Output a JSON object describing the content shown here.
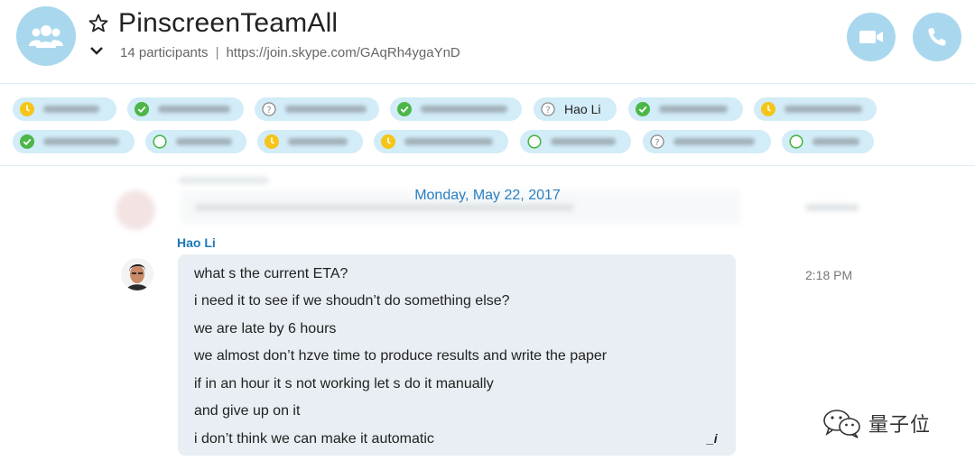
{
  "header": {
    "title": "PinscreenTeamAll",
    "participants_count": "14 participants",
    "separator": "|",
    "join_link": "https://join.skype.com/GAqRh4ygaYnD",
    "icons": {
      "group": "group-icon",
      "favorite": "star-icon",
      "expand": "chevron-down-icon",
      "video": "video-call-icon",
      "audio": "phone-icon"
    }
  },
  "colors": {
    "accent_light": "#a9d8ee",
    "chip_bg": "#d2ecf8",
    "status_online": "#4cb748",
    "status_away": "#f5c518",
    "status_unknown": "#8a8a8a",
    "link_blue": "#2a7fc1",
    "bubble_bg": "#e8eef3"
  },
  "participants": [
    {
      "status": "away",
      "name": ""
    },
    {
      "status": "online",
      "name": ""
    },
    {
      "status": "unknown",
      "name": ""
    },
    {
      "status": "online",
      "name": ""
    },
    {
      "status": "unknown",
      "name": "Hao Li"
    },
    {
      "status": "online",
      "name": ""
    },
    {
      "status": "away",
      "name": ""
    },
    {
      "status": "online",
      "name": ""
    },
    {
      "status": "offline",
      "name": ""
    },
    {
      "status": "away",
      "name": ""
    },
    {
      "status": "away",
      "name": ""
    },
    {
      "status": "offline",
      "name": ""
    },
    {
      "status": "unknown",
      "name": ""
    },
    {
      "status": "offline",
      "name": ""
    }
  ],
  "chat": {
    "date": "Monday, May 22, 2017",
    "sender": "Hao Li",
    "time": "2:18 PM",
    "messages": [
      "what s the current ETA?",
      "i need it to see if we shoudn’t do something else?",
      "we are late by 6 hours",
      "we almost don’t hzve time to produce results and write the paper",
      "if in an hour it s not working let s do it manually",
      "and give up on it",
      "i don’t think we can make it automatic"
    ],
    "edit_indicator": "_i"
  },
  "watermark": {
    "text": "量子位",
    "icon": "wechat-logo-icon"
  }
}
